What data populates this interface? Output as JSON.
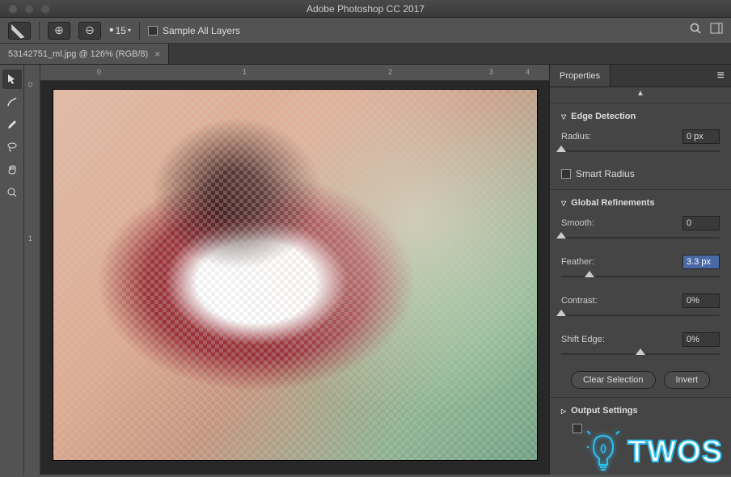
{
  "app": {
    "title": "Adobe Photoshop CC 2017"
  },
  "optionsBar": {
    "quickSelectValue": "15",
    "sampleAllLayers": "Sample All Layers"
  },
  "documentTab": {
    "label": "53142751_ml.jpg @ 126% (RGB/8)"
  },
  "rulerLeft": {
    "t0": "0",
    "t1": "1"
  },
  "panel": {
    "tab": "Properties",
    "edgeDetection": {
      "title": "Edge Detection",
      "radiusLabel": "Radius:",
      "radiusValue": "0 px",
      "smartRadius": "Smart Radius"
    },
    "globalRefinements": {
      "title": "Global Refinements",
      "smoothLabel": "Smooth:",
      "smoothValue": "0",
      "featherLabel": "Feather:",
      "featherValue": "3.3 px",
      "contrastLabel": "Contrast:",
      "contrastValue": "0%",
      "shiftEdgeLabel": "Shift Edge:",
      "shiftEdgeValue": "0%",
      "clearSelection": "Clear Selection",
      "invert": "Invert"
    },
    "outputSettings": {
      "title": "Output Settings"
    }
  },
  "watermark": {
    "text": "TWOS"
  }
}
